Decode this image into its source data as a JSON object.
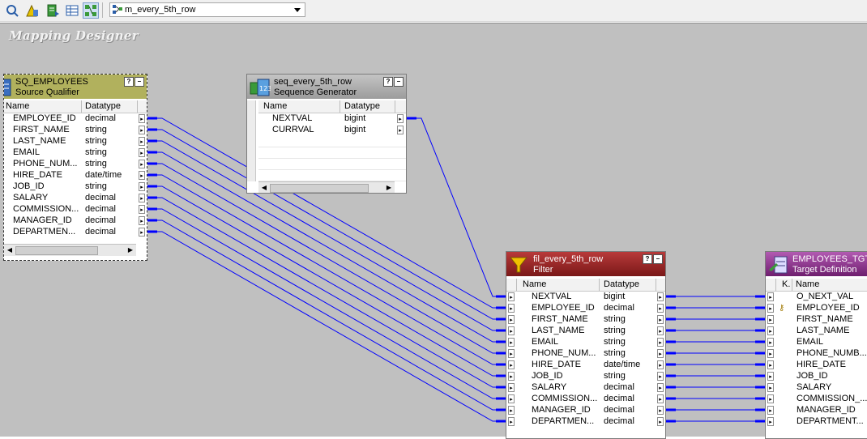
{
  "toolbar": {
    "buttons": [
      "transformation-icon",
      "source-analyzer-icon",
      "target-designer-icon",
      "transformation-developer-icon",
      "mapping-designer-icon"
    ],
    "mapping_selector": {
      "value": "m_every_5th_row"
    }
  },
  "canvas": {
    "title": "Mapping Designer"
  },
  "colors": {
    "link": "#0000ff",
    "source_qualifier_header": "#b1b15d",
    "sequence_header": "#a3a3a3",
    "filter_header": "#8c1f1f",
    "target_header": "#7a1f7a"
  },
  "source_qualifier": {
    "name": "SQ_EMPLOYEES",
    "type": "Source Qualifier",
    "col_name": "Name",
    "col_type": "Datatype",
    "rows": [
      {
        "name": "EMPLOYEE_ID",
        "type": "decimal"
      },
      {
        "name": "FIRST_NAME",
        "type": "string"
      },
      {
        "name": "LAST_NAME",
        "type": "string"
      },
      {
        "name": "EMAIL",
        "type": "string"
      },
      {
        "name": "PHONE_NUM...",
        "type": "string"
      },
      {
        "name": "HIRE_DATE",
        "type": "date/time"
      },
      {
        "name": "JOB_ID",
        "type": "string"
      },
      {
        "name": "SALARY",
        "type": "decimal"
      },
      {
        "name": "COMMISSION...",
        "type": "decimal"
      },
      {
        "name": "MANAGER_ID",
        "type": "decimal"
      },
      {
        "name": "DEPARTMEN...",
        "type": "decimal"
      }
    ]
  },
  "sequence": {
    "name": "seq_every_5th_row",
    "type": "Sequence Generator",
    "col_name": "Name",
    "col_type": "Datatype",
    "rows": [
      {
        "name": "NEXTVAL",
        "type": "bigint"
      },
      {
        "name": "CURRVAL",
        "type": "bigint"
      }
    ]
  },
  "filter": {
    "name": "fil_every_5th_row",
    "type": "Filter",
    "col_name": "Name",
    "col_type": "Datatype",
    "rows": [
      {
        "name": "NEXTVAL",
        "type": "bigint"
      },
      {
        "name": "EMPLOYEE_ID",
        "type": "decimal"
      },
      {
        "name": "FIRST_NAME",
        "type": "string"
      },
      {
        "name": "LAST_NAME",
        "type": "string"
      },
      {
        "name": "EMAIL",
        "type": "string"
      },
      {
        "name": "PHONE_NUM...",
        "type": "string"
      },
      {
        "name": "HIRE_DATE",
        "type": "date/time"
      },
      {
        "name": "JOB_ID",
        "type": "string"
      },
      {
        "name": "SALARY",
        "type": "decimal"
      },
      {
        "name": "COMMISSION...",
        "type": "decimal"
      },
      {
        "name": "MANAGER_ID",
        "type": "decimal"
      },
      {
        "name": "DEPARTMEN...",
        "type": "decimal"
      }
    ]
  },
  "target": {
    "name": "EMPLOYEES_TGT",
    "type": "Target Definition",
    "col_key": "K.",
    "col_name": "Name",
    "rows": [
      {
        "name": "O_NEXT_VAL",
        "key": false
      },
      {
        "name": "EMPLOYEE_ID",
        "key": true
      },
      {
        "name": "FIRST_NAME",
        "key": false
      },
      {
        "name": "LAST_NAME",
        "key": false
      },
      {
        "name": "EMAIL",
        "key": false
      },
      {
        "name": "PHONE_NUMB...",
        "key": false
      },
      {
        "name": "HIRE_DATE",
        "key": false
      },
      {
        "name": "JOB_ID",
        "key": false
      },
      {
        "name": "SALARY",
        "key": false
      },
      {
        "name": "COMMISSION_...",
        "key": false
      },
      {
        "name": "MANAGER_ID",
        "key": false
      },
      {
        "name": "DEPARTMENT...",
        "key": false
      }
    ]
  }
}
